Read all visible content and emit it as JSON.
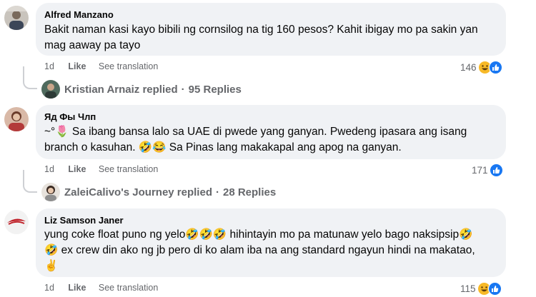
{
  "comments": [
    {
      "author": "Alfred Manzano",
      "lines": [
        "Bakit naman kasi kayo bibili ng cornsilog na tig 160 pesos? Kahit ibigay mo pa sakin yan",
        "mag aaway pa tayo"
      ],
      "time": "1d",
      "like_label": "Like",
      "translate_label": "See translation",
      "reaction_count": "146",
      "reactions": [
        "haha-icon",
        "like-icon"
      ],
      "reply_author_text": "Kristian Arnaiz replied",
      "reply_count_text": "95 Replies"
    },
    {
      "author": "Яд Фы Члп",
      "lines": [
        "~°🌷 Sa ibang bansa lalo sa UAE di pwede yang ganyan. Pwedeng ipasara ang isang",
        "branch o kasuhan. 🤣😂 Sa Pinas lang makakapal ang apog na ganyan."
      ],
      "time": "1d",
      "like_label": "Like",
      "translate_label": "See translation",
      "reaction_count": "171",
      "reactions": [
        "like-icon"
      ],
      "reply_author_text": "ZaleiCalivo's Journey replied",
      "reply_count_text": "28 Replies"
    },
    {
      "author": "Liz Samson Janer",
      "lines": [
        "yung coke float puno ng yelo🤣🤣🤣 hihintayin mo pa matunaw yelo bago naksipsip🤣",
        "🤣 ex crew din ako ng jb pero di ko alam iba na ang standard ngayun hindi na makatao,",
        "✌️"
      ],
      "time": "1d",
      "like_label": "Like",
      "translate_label": "See translation",
      "reaction_count": "115",
      "reactions": [
        "haha-icon",
        "like-icon"
      ]
    }
  ],
  "separator": "·",
  "colors": {
    "bubble": "#f0f2f5",
    "meta": "#65676b",
    "like_blue": "#1877f2",
    "haha_yellow": "#f7b928"
  }
}
